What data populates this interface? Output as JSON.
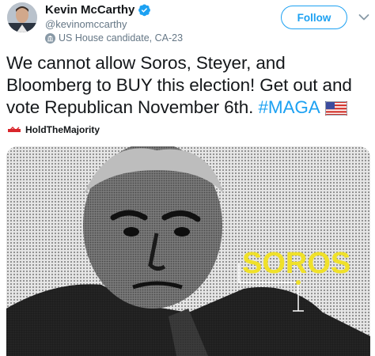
{
  "user": {
    "display_name": "Kevin McCarthy",
    "handle": "@kevinomccarthy",
    "label": "US House candidate, CA-23"
  },
  "header": {
    "follow_label": "Follow"
  },
  "tweet": {
    "text_main": "We cannot allow Soros, Steyer, and Bloomberg to BUY this election! Get out and vote Republican November 6th.",
    "hashtag": "#MAGA"
  },
  "promo": {
    "name": "HoldTheMajority"
  },
  "media": {
    "overlay_text": "SOROS"
  },
  "colors": {
    "accent": "#1da1f2",
    "overlay_yellow": "#f0e12a",
    "text_primary": "#14171a",
    "text_secondary": "#657786"
  },
  "icons": {
    "verified": "verified-badge-icon",
    "label": "government-building-icon",
    "caret": "chevron-down-icon",
    "flag": "us-flag-emoji",
    "promo": "holdthemajority-logo-icon"
  }
}
